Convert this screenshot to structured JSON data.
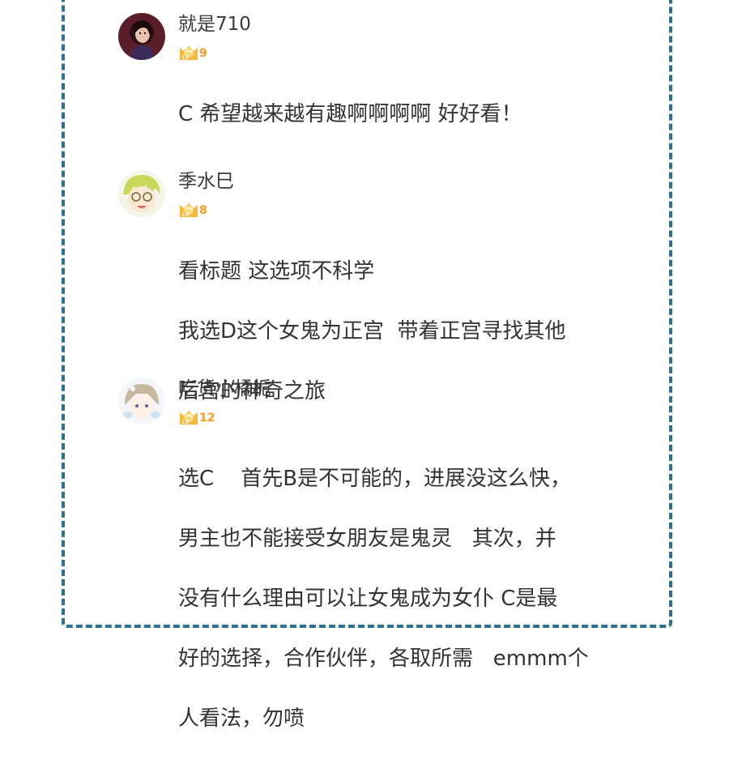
{
  "comments": [
    {
      "username": "就是710",
      "level_label": "LV",
      "level": "9",
      "lines": [
        "C 希望越来越有趣啊啊啊啊 好好看！"
      ]
    },
    {
      "username": "季水巳",
      "level_label": "LV",
      "level": "8",
      "lines": [
        "看标题 这选项不科学",
        "我选D这个女鬼为正宫  带着正宫寻找其他",
        "后宫的神奇之旅"
      ]
    },
    {
      "username": "吃货小橘栀",
      "level_label": "LV",
      "level": "12",
      "lines": [
        "选C    首先B是不可能的，进展没这么快，",
        "男主也不能接受女朋友是鬼灵   其次，并",
        "没有什么理由可以让女鬼成为女仆 C是最",
        "好的选择，合作伙伴，各取所需   emmm个",
        "人看法，勿喷"
      ]
    }
  ],
  "colors": {
    "border": "#2f6f8f",
    "badge": "#f5b940",
    "text": "#333333",
    "username": "#3a3a3a"
  }
}
